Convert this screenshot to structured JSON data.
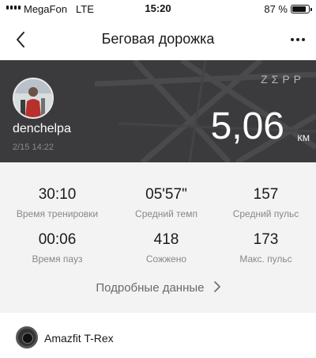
{
  "status_bar": {
    "carrier": "MegaFon",
    "network": "LTE",
    "time": "15:20",
    "battery": "87 %",
    "battery_level": 0.87
  },
  "nav": {
    "title": "Беговая дорожка",
    "back_icon": "chevron-left-icon",
    "more_icon": "more-horizontal-icon"
  },
  "workout": {
    "username": "denchelpa",
    "date": "2/15 14:22",
    "brand": "ZΣPP",
    "distance": "5,06",
    "unit": "КМ"
  },
  "stats": [
    {
      "value": "30:10",
      "label": "Время тренировки"
    },
    {
      "value": "05'57\"",
      "label": "Средний темп"
    },
    {
      "value": "157",
      "label": "Средний пульс"
    },
    {
      "value": "00:06",
      "label": "Время пауз"
    },
    {
      "value": "418",
      "label": "Сожжено"
    },
    {
      "value": "173",
      "label": "Макс. пульс"
    }
  ],
  "details_link": "Подробные данные",
  "device": {
    "name": "Amazfit T-Rex",
    "icon": "watch-icon"
  },
  "colors": {
    "banner_bg": "#3b3b3d",
    "stats_bg": "#f3f3f4"
  }
}
